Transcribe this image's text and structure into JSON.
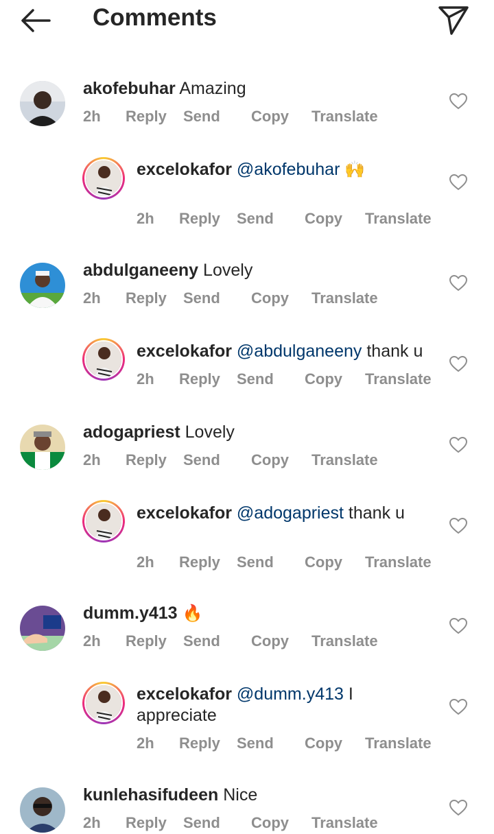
{
  "header": {
    "title": "Comments"
  },
  "actions": {
    "reply": "Reply",
    "send": "Send",
    "copy": "Copy",
    "translate": "Translate"
  },
  "comments": [
    {
      "user": "akofebuhar",
      "text": "Amazing",
      "time": "2h"
    },
    {
      "user": "excelokafor",
      "mention": "@akofebuhar",
      "text": "🙌",
      "time": "2h"
    },
    {
      "user": "abdulganeeny",
      "text": "Lovely",
      "time": "2h"
    },
    {
      "user": "excelokafor",
      "mention": "@abdulganeeny",
      "text": "thank u",
      "time": "2h"
    },
    {
      "user": "adogapriest",
      "text": "Lovely",
      "time": "2h"
    },
    {
      "user": "excelokafor",
      "mention": "@adogapriest",
      "text": "thank u",
      "time": "2h"
    },
    {
      "user": "dumm.y413",
      "text": "🔥",
      "time": "2h"
    },
    {
      "user": "excelokafor",
      "mention": "@dumm.y413",
      "text": "I appreciate",
      "time": "2h"
    },
    {
      "user": "kunlehasifudeen",
      "text": "Nice",
      "time": "2h"
    }
  ],
  "colors": {
    "mention": "#00376b",
    "meta": "#8e8e8e",
    "text": "#262626"
  }
}
